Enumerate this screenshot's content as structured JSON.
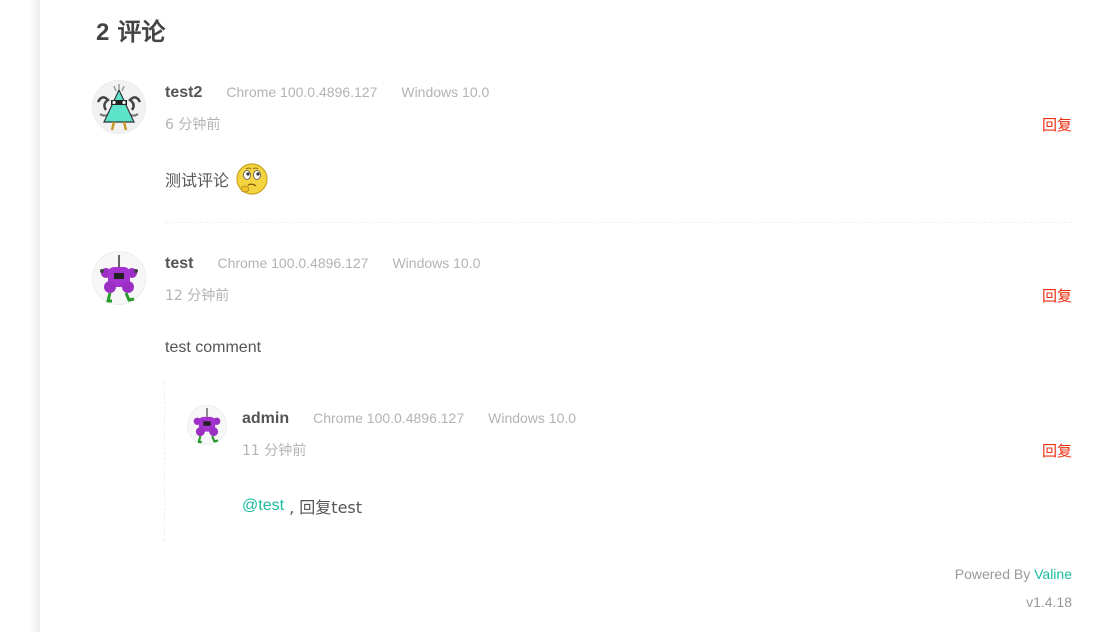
{
  "header": {
    "count": "2",
    "label": "评论"
  },
  "comments": [
    {
      "nick": "test2",
      "browser": "Chrome 100.0.4896.127",
      "os": "Windows 10.0",
      "time": "6 分钟前",
      "reply_label": "回复",
      "text": "测试评论",
      "emoji": "thinking-face-icon"
    },
    {
      "nick": "test",
      "browser": "Chrome 100.0.4896.127",
      "os": "Windows 10.0",
      "time": "12 分钟前",
      "reply_label": "回复",
      "text": "test comment",
      "children": [
        {
          "nick": "admin",
          "browser": "Chrome 100.0.4896.127",
          "os": "Windows 10.0",
          "time": "11 分钟前",
          "reply_label": "回复",
          "mention": "@test",
          "text": " , 回复test"
        }
      ]
    }
  ],
  "footer": {
    "powered_by": "Powered By",
    "brand": "Valine",
    "version": "v1.4.18"
  },
  "colors": {
    "reply": "#ef2f11",
    "link": "#1abc9c",
    "muted": "#b3b3b3"
  }
}
